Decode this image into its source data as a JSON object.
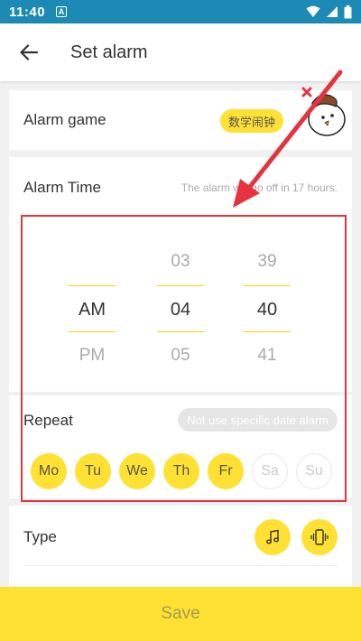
{
  "status_bar": {
    "time": "11:40",
    "notification_letter": "A"
  },
  "app_bar": {
    "title": "Set alarm"
  },
  "alarm_game": {
    "label": "Alarm game",
    "game_name": "数学闹钟"
  },
  "alarm_time": {
    "label": "Alarm Time",
    "hint": "The alarm will go off in 17 hours.",
    "ampm": {
      "above": "",
      "selected": "AM",
      "below": "PM"
    },
    "hour": {
      "above": "03",
      "selected": "04",
      "below": "05"
    },
    "minute": {
      "above": "39",
      "selected": "40",
      "below": "41"
    }
  },
  "repeat": {
    "label": "Repeat",
    "specific_date_label": "Not use specific date alarm",
    "days": [
      {
        "label": "Mo",
        "active": true
      },
      {
        "label": "Tu",
        "active": true
      },
      {
        "label": "We",
        "active": true
      },
      {
        "label": "Th",
        "active": true
      },
      {
        "label": "Fr",
        "active": true
      },
      {
        "label": "Sa",
        "active": false
      },
      {
        "label": "Su",
        "active": false
      }
    ]
  },
  "type": {
    "label": "Type",
    "options": [
      "music-note-icon",
      "vibrate-phone-icon"
    ]
  },
  "save_label": "Save",
  "colors": {
    "status_bar": "#1d8ab5",
    "accent_yellow": "#ffe133",
    "annotation_red": "#e53340"
  }
}
